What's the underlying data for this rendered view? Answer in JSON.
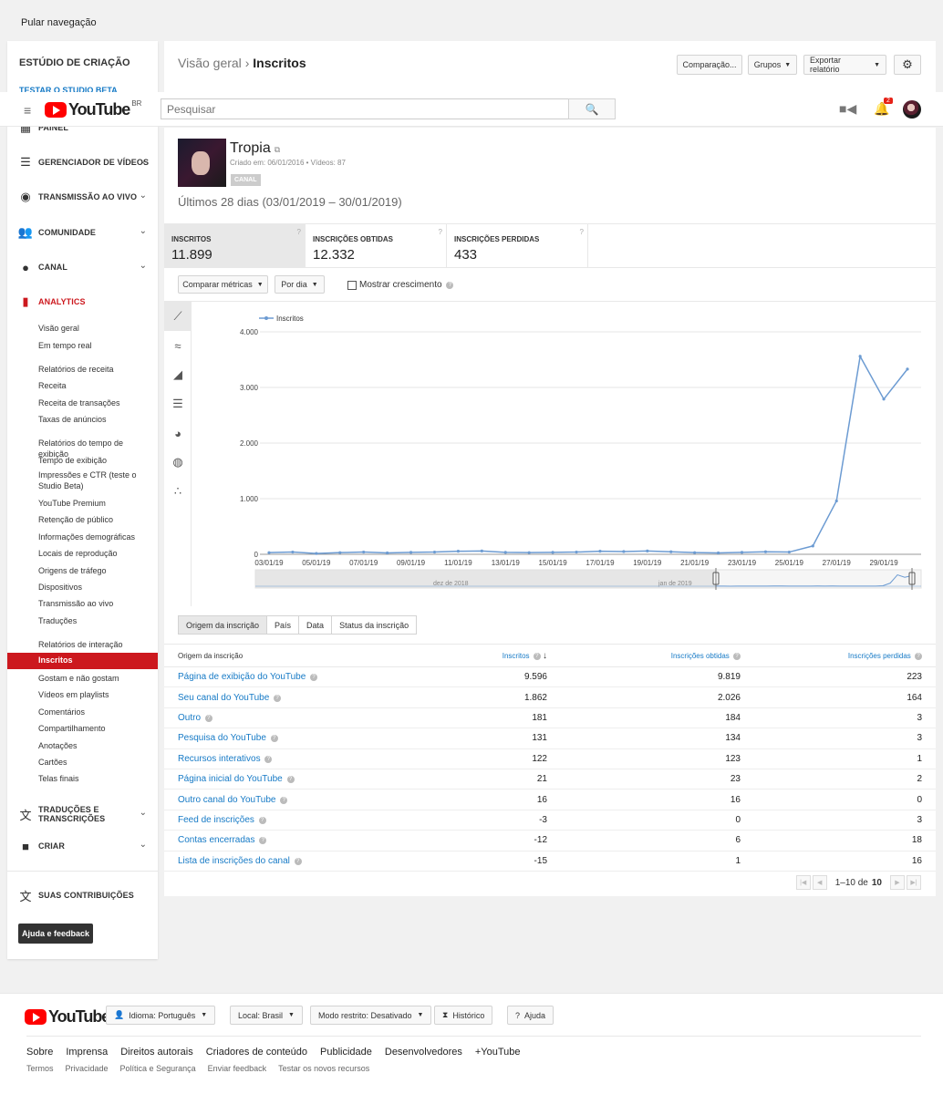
{
  "skip_nav": "Pular navegação",
  "sidebar": {
    "studio_title": "ESTÚDIO DE CRIAÇÃO",
    "beta_link": "TESTAR O STUDIO BETA",
    "dashboard": "PAINEL",
    "video_manager": "GERENCIADOR DE VÍDEOS",
    "live": "TRANSMISSÃO AO VIVO",
    "community": "COMUNIDADE",
    "channel": "CANAL",
    "analytics": "ANALYTICS",
    "items": [
      "Visão geral",
      "Em tempo real"
    ],
    "revenue_group": "Relatórios de receita",
    "revenue_items": [
      "Receita",
      "Receita de transações",
      "Taxas de anúncios"
    ],
    "watch_group": "Relatórios do tempo de exibição",
    "watch_items": [
      "Tempo de exibição",
      "Impressões e CTR (teste o Studio Beta)",
      "YouTube Premium",
      "Retenção de público",
      "Informações demográficas",
      "Locais de reprodução",
      "Origens de tráfego",
      "Dispositivos",
      "Transmissão ao vivo",
      "Traduções"
    ],
    "interaction_group": "Relatórios de interação",
    "active_item": "Inscritos",
    "interaction_items": [
      "Gostam e não gostam",
      "Vídeos em playlists",
      "Comentários",
      "Compartilhamento",
      "Anotações",
      "Cartões",
      "Telas finais"
    ],
    "translations": "TRADUÇÕES E TRANSCRIÇÕES",
    "create": "CRIAR",
    "contributions": "SUAS CONTRIBUIÇÕES",
    "help_button": "Ajuda e feedback"
  },
  "header": {
    "crumb_parent": "Visão geral",
    "crumb_sep": "›",
    "crumb_current": "Inscritos",
    "compare_btn": "Comparação...",
    "groups_btn": "Grupos",
    "export_btn": "Exportar relatório"
  },
  "masthead": {
    "logo": "YouTube",
    "region": "BR",
    "search_placeholder": "Pesquisar",
    "notif_count": "2"
  },
  "channel": {
    "name": "Tropia",
    "created": "Criado em: 06/01/2016",
    "dot": "•",
    "videos": "Vídeos: 87",
    "tag": "CANAL",
    "period": "Últimos 28 dias (03/01/2019 – 30/01/2019)"
  },
  "metrics": [
    {
      "title": "INSCRITOS",
      "value": "11.899"
    },
    {
      "title": "INSCRIÇÕES OBTIDAS",
      "value": "12.332"
    },
    {
      "title": "INSCRIÇÕES PERDIDAS",
      "value": "433"
    }
  ],
  "toolbar": {
    "compare_metrics": "Comparar métricas",
    "per_day": "Por dia",
    "show_growth": "Mostrar crescimento"
  },
  "chart_data": {
    "type": "line",
    "legend": "Inscritos",
    "x": [
      "03/01/19",
      "04/01/19",
      "05/01/19",
      "06/01/19",
      "07/01/19",
      "08/01/19",
      "09/01/19",
      "10/01/19",
      "11/01/19",
      "12/01/19",
      "13/01/19",
      "14/01/19",
      "15/01/19",
      "16/01/19",
      "17/01/19",
      "18/01/19",
      "19/01/19",
      "20/01/19",
      "21/01/19",
      "22/01/19",
      "23/01/19",
      "24/01/19",
      "25/01/19",
      "26/01/19",
      "27/01/19",
      "28/01/19",
      "29/01/19",
      "30/01/19"
    ],
    "x_tick_labels": [
      "03/01/19",
      "05/01/19",
      "07/01/19",
      "09/01/19",
      "11/01/19",
      "13/01/19",
      "15/01/19",
      "17/01/19",
      "19/01/19",
      "21/01/19",
      "23/01/19",
      "25/01/19",
      "27/01/19",
      "29/01/19"
    ],
    "series": [
      {
        "name": "Inscritos",
        "values": [
          30,
          40,
          15,
          30,
          40,
          25,
          35,
          40,
          55,
          60,
          35,
          30,
          35,
          40,
          55,
          50,
          60,
          45,
          30,
          25,
          35,
          45,
          40,
          150,
          960,
          3560,
          2790,
          3330
        ]
      }
    ],
    "ylim": [
      0,
      4000
    ],
    "y_ticks": [
      "0",
      "1.000",
      "2.000",
      "3.000",
      "4.000"
    ],
    "navigator_labels": [
      "dez de 2018",
      "jan de 2019"
    ],
    "grid": true,
    "legend_position": "top-left"
  },
  "tabs": [
    "Origem da inscrição",
    "País",
    "Data",
    "Status da inscrição"
  ],
  "table": {
    "headers": [
      "Origem da inscrição",
      "Inscritos",
      "Inscrições obtidas",
      "Inscrições perdidas"
    ],
    "rows": [
      [
        "Página de exibição do YouTube",
        "9.596",
        "9.819",
        "223"
      ],
      [
        "Seu canal do YouTube",
        "1.862",
        "2.026",
        "164"
      ],
      [
        "Outro",
        "181",
        "184",
        "3"
      ],
      [
        "Pesquisa do YouTube",
        "131",
        "134",
        "3"
      ],
      [
        "Recursos interativos",
        "122",
        "123",
        "1"
      ],
      [
        "Página inicial do YouTube",
        "21",
        "23",
        "2"
      ],
      [
        "Outro canal do YouTube",
        "16",
        "16",
        "0"
      ],
      [
        "Feed de inscrições",
        "-3",
        "0",
        "3"
      ],
      [
        "Contas encerradas",
        "-12",
        "6",
        "18"
      ],
      [
        "Lista de inscrições do canal",
        "-15",
        "1",
        "16"
      ]
    ],
    "pager_range": "1–10 de",
    "pager_total": "10"
  },
  "footer": {
    "logo": "YouTube",
    "language": "Idioma: Português",
    "location": "Local: Brasil",
    "restricted": "Modo restrito: Desativado",
    "history": "Histórico",
    "help": "Ajuda",
    "links": [
      "Sobre",
      "Imprensa",
      "Direitos autorais",
      "Criadores de conteúdo",
      "Publicidade",
      "Desenvolvedores",
      "+YouTube"
    ],
    "links2": [
      "Termos",
      "Privacidade",
      "Política e Segurança",
      "Enviar feedback",
      "Testar os novos recursos"
    ]
  },
  "colors": {
    "brand_red": "#cc181e",
    "link_blue": "#167ac6",
    "line_blue": "#6c9bd2"
  }
}
